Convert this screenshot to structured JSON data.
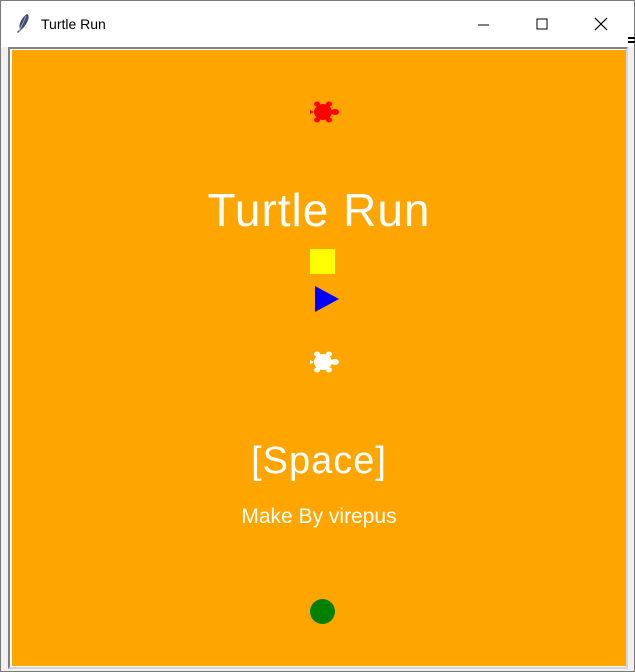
{
  "window": {
    "title": "Turtle Run",
    "icon": "feather-icon",
    "controls": [
      "minimize-icon",
      "maximize-icon",
      "close-icon"
    ]
  },
  "game": {
    "background_color": "#ffa500",
    "title": "Turtle Run",
    "prompt": "[Space]",
    "credit": "Make By virepus",
    "sprites": [
      {
        "name": "turtle",
        "color": "#ff0000"
      },
      {
        "name": "square",
        "color": "#ffff00"
      },
      {
        "name": "arrow",
        "color": "#0000ff"
      },
      {
        "name": "turtle",
        "color": "#ffffff"
      },
      {
        "name": "circle",
        "color": "#008000"
      }
    ]
  }
}
